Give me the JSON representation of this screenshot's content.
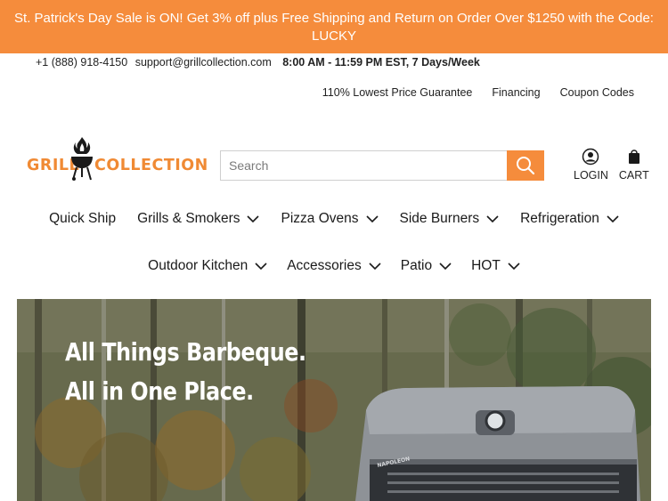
{
  "promo": {
    "line1": "St. Patrick's Day Sale is ON! Get 3% off plus Free Shipping and Return on Order Over $1250 with the Code:",
    "line2": "LUCKY",
    "color": "#f58c3c"
  },
  "contact": {
    "phone": "+1 (888) 918-4150",
    "email": "support@grillcollection.com",
    "hours": "8:00 AM - 11:59 PM EST, 7 Days/Week"
  },
  "util_links": [
    "110% Lowest Price Guarantee",
    "Financing",
    "Coupon Codes"
  ],
  "logo": {
    "word1": "GRILL",
    "word2": "COLLECTION",
    "color": "#f08a34"
  },
  "search": {
    "placeholder": "Search",
    "button_icon": "search-icon"
  },
  "account": {
    "login_label": "LOGIN",
    "cart_label": "CART"
  },
  "nav": {
    "row1": [
      "Quick Ship",
      "Grills & Smokers",
      "Pizza Ovens",
      "Side Burners",
      "Refrigeration"
    ],
    "row2": [
      "Outdoor Kitchen",
      "Accessories",
      "Patio",
      "HOT"
    ]
  },
  "hero": {
    "title_line1": "All Things Barbeque.",
    "title_line2": "All in One Place.",
    "grill_brand": "NAPOLEON"
  }
}
